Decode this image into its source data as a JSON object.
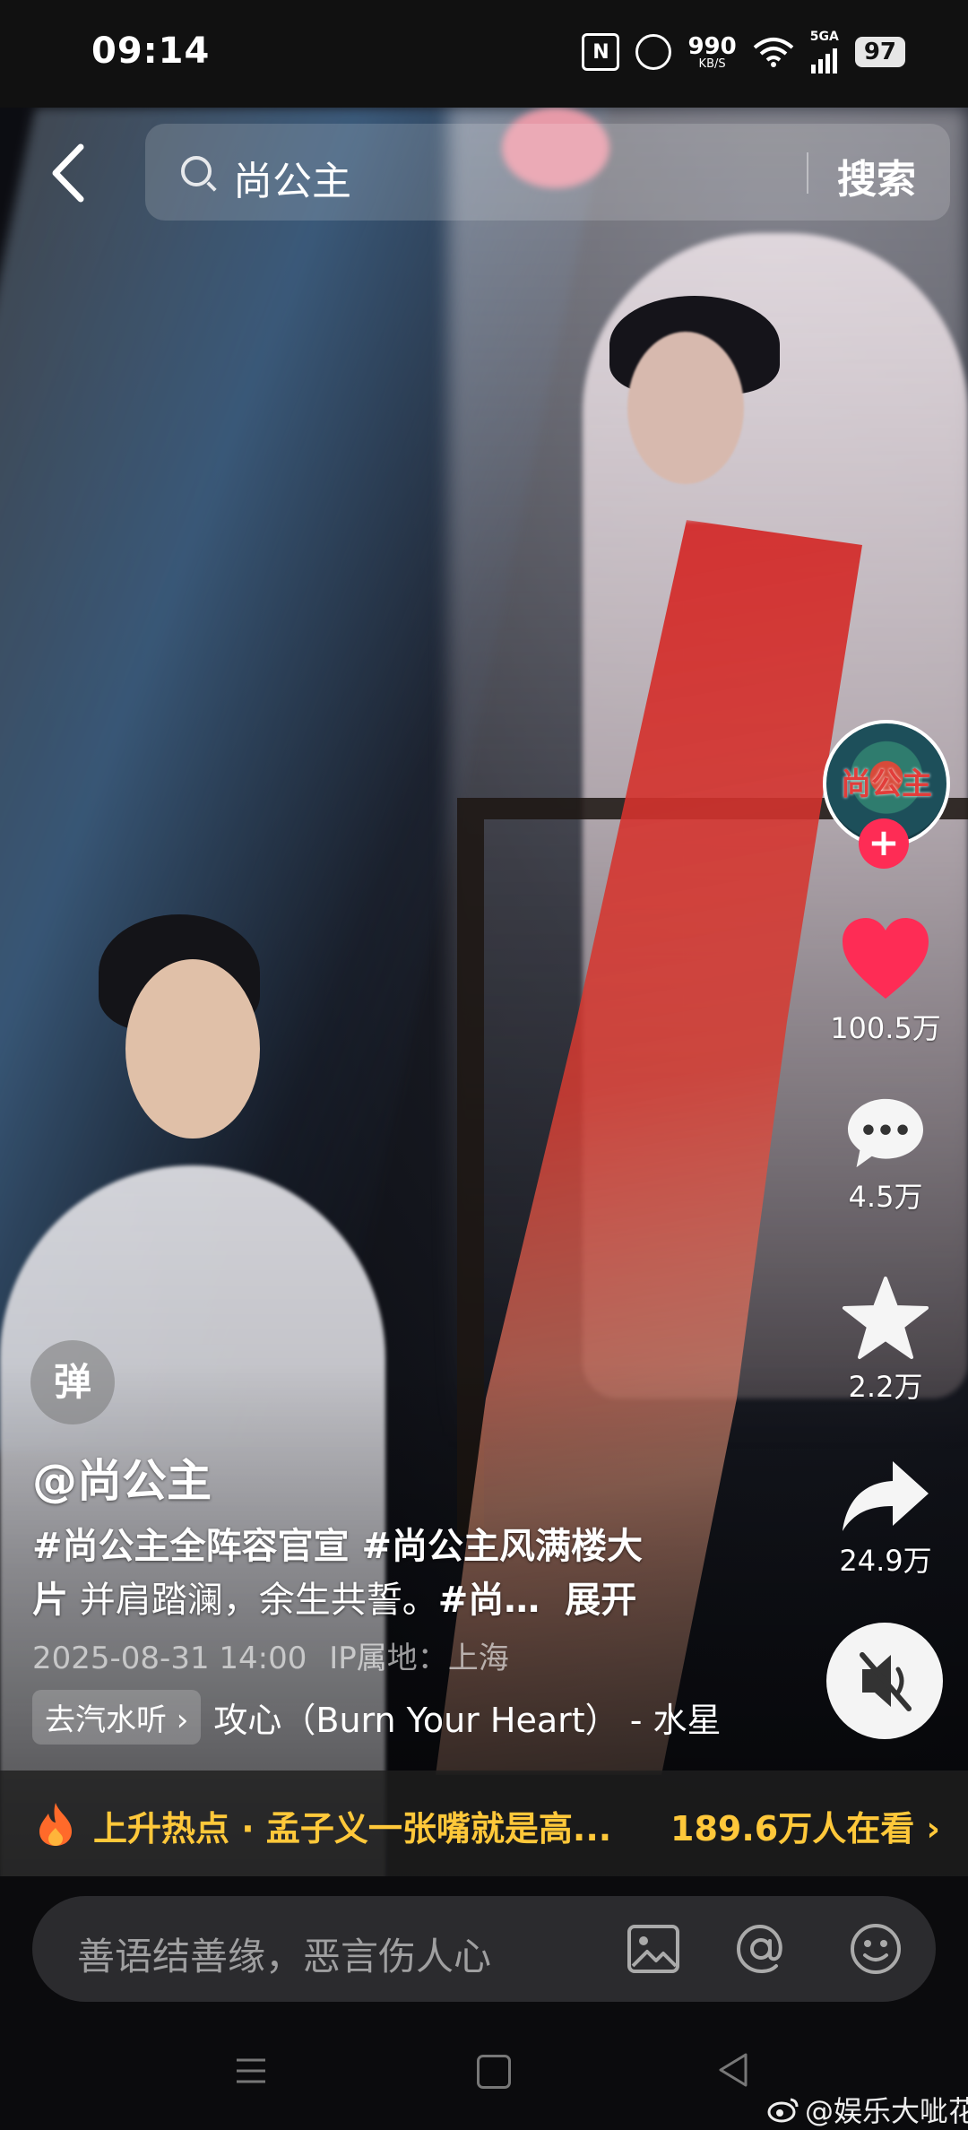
{
  "status_bar": {
    "time": "09:14",
    "nfc": "N",
    "speed_value": "990",
    "speed_unit": "KB/S",
    "network": "5GA",
    "battery": "97"
  },
  "search": {
    "query": "尚公主",
    "button": "搜索"
  },
  "rail": {
    "avatar_text": "尚公主",
    "follow": "+",
    "likes": "100.5万",
    "comments": "4.5万",
    "favorites": "2.2万",
    "shares": "24.9万"
  },
  "post": {
    "danmu": "弹",
    "author": "@尚公主",
    "desc_line1": "#尚公主全阵容官宣 #尚公主风满楼大",
    "desc_line2_a": "片",
    "desc_line2_b": " 并肩踏澜，余生共誓。",
    "desc_line2_c": "#尚…",
    "expand": "展开",
    "date": "2025-08-31 14:00",
    "ip": "IP属地：上海",
    "music_pill": "去汽水听 ›",
    "music_title": "攻心（Burn Your Heart） - 水星"
  },
  "hot": {
    "text": "上升热点 · 孟子义一张嘴就是高...",
    "count": "189.6万人在看 ›"
  },
  "comment": {
    "placeholder": "善语结善缘，恶言伤人心"
  },
  "watermark": "@娱乐大呲花",
  "colors": {
    "accent": "#fe2c55",
    "hot": "#ffc83a"
  },
  "icons": [
    "back-icon",
    "search-icon",
    "heart-icon",
    "comment-icon",
    "star-icon",
    "share-icon",
    "mute-icon",
    "flame-icon",
    "image-icon",
    "at-icon",
    "emoji-icon"
  ]
}
